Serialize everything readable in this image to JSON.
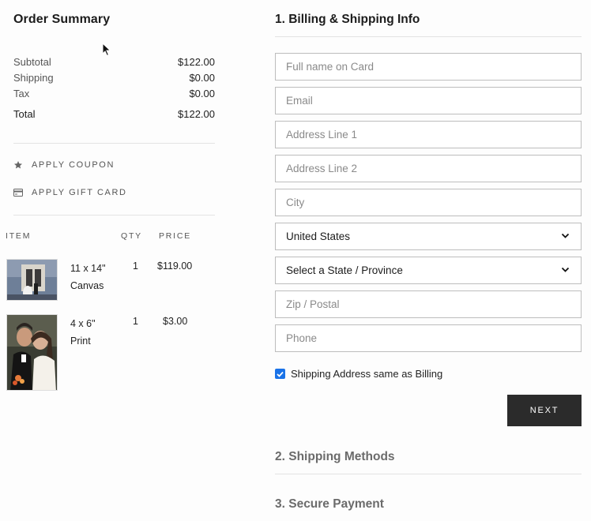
{
  "summary": {
    "title": "Order Summary",
    "rows": [
      {
        "label": "Subtotal",
        "value": "$122.00"
      },
      {
        "label": "Shipping",
        "value": "$0.00"
      },
      {
        "label": "Tax",
        "value": "$0.00"
      }
    ],
    "total": {
      "label": "Total",
      "value": "$122.00"
    }
  },
  "promo": {
    "coupon_label": "APPLY COUPON",
    "giftcard_label": "APPLY GIFT CARD"
  },
  "items": {
    "headers": {
      "item": "ITEM",
      "qty": "QTY",
      "price": "PRICE"
    },
    "rows": [
      {
        "name_line1": "11 x 14\"",
        "name_line2": "Canvas",
        "qty": "1",
        "price": "$119.00"
      },
      {
        "name_line1": "4 x 6\"",
        "name_line2": "Print",
        "qty": "1",
        "price": "$3.00"
      }
    ]
  },
  "checkout": {
    "step1_title": "1. Billing & Shipping Info",
    "step2_title": "2. Shipping Methods",
    "step3_title": "3. Secure Payment",
    "fields": {
      "full_name_placeholder": "Full name on Card",
      "email_placeholder": "Email",
      "address1_placeholder": "Address Line 1",
      "address2_placeholder": "Address Line 2",
      "city_placeholder": "City",
      "country_value": "United States",
      "state_value": "Select a State / Province",
      "zip_placeholder": "Zip / Postal",
      "phone_placeholder": "Phone"
    },
    "same_as_billing_label": "Shipping Address same as Billing",
    "same_as_billing_checked": true,
    "next_label": "NEXT"
  },
  "colors": {
    "checkbox": "#1a73e8",
    "button_bg": "#2b2b2b"
  },
  "icons": {
    "coupon": "star-icon",
    "giftcard": "credit-card-icon",
    "select": "chevron-down-icon"
  }
}
